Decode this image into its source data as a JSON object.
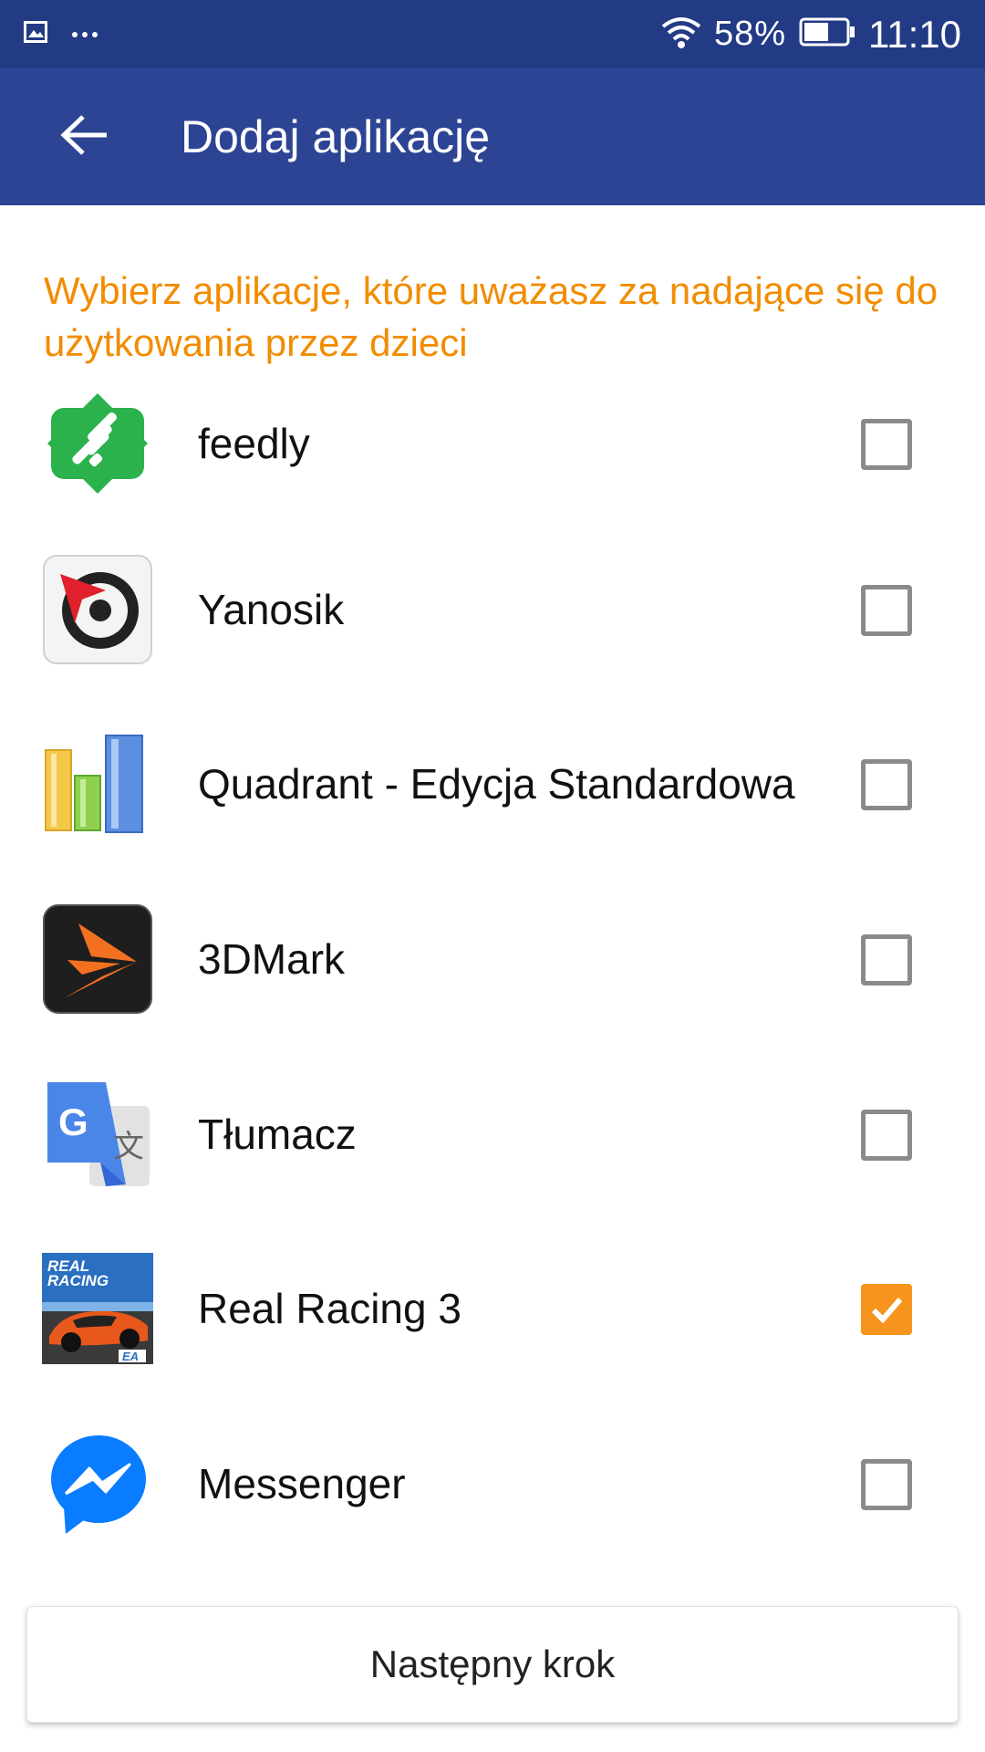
{
  "status_bar": {
    "battery_percent": "58%",
    "time": "11:10",
    "icons": [
      "gallery-icon",
      "more-dots-icon",
      "wifi-icon",
      "battery-icon"
    ]
  },
  "app_bar": {
    "back_icon": "arrow-left-icon",
    "title": "Dodaj aplikację"
  },
  "instruction": "Wybierz aplikacje, które uważasz za nadające się do użytkowania przez dzieci",
  "apps": [
    {
      "name": "feedly",
      "icon": "feedly-icon",
      "checked": false
    },
    {
      "name": "Yanosik",
      "icon": "yanosik-icon",
      "checked": false
    },
    {
      "name": "Quadrant - Edycja Standardowa",
      "icon": "quadrant-icon",
      "checked": false
    },
    {
      "name": "3DMark",
      "icon": "3dmark-icon",
      "checked": false
    },
    {
      "name": "Tłumacz",
      "icon": "translate-icon",
      "checked": false
    },
    {
      "name": "Real Racing 3",
      "icon": "real-racing-icon",
      "checked": true
    },
    {
      "name": "Messenger",
      "icon": "messenger-icon",
      "checked": false
    }
  ],
  "next_button": "Następny krok",
  "colors": {
    "status_bar": "#233a85",
    "app_bar": "#2c4493",
    "accent": "#f28c00",
    "checkbox_checked": "#f7941d"
  }
}
